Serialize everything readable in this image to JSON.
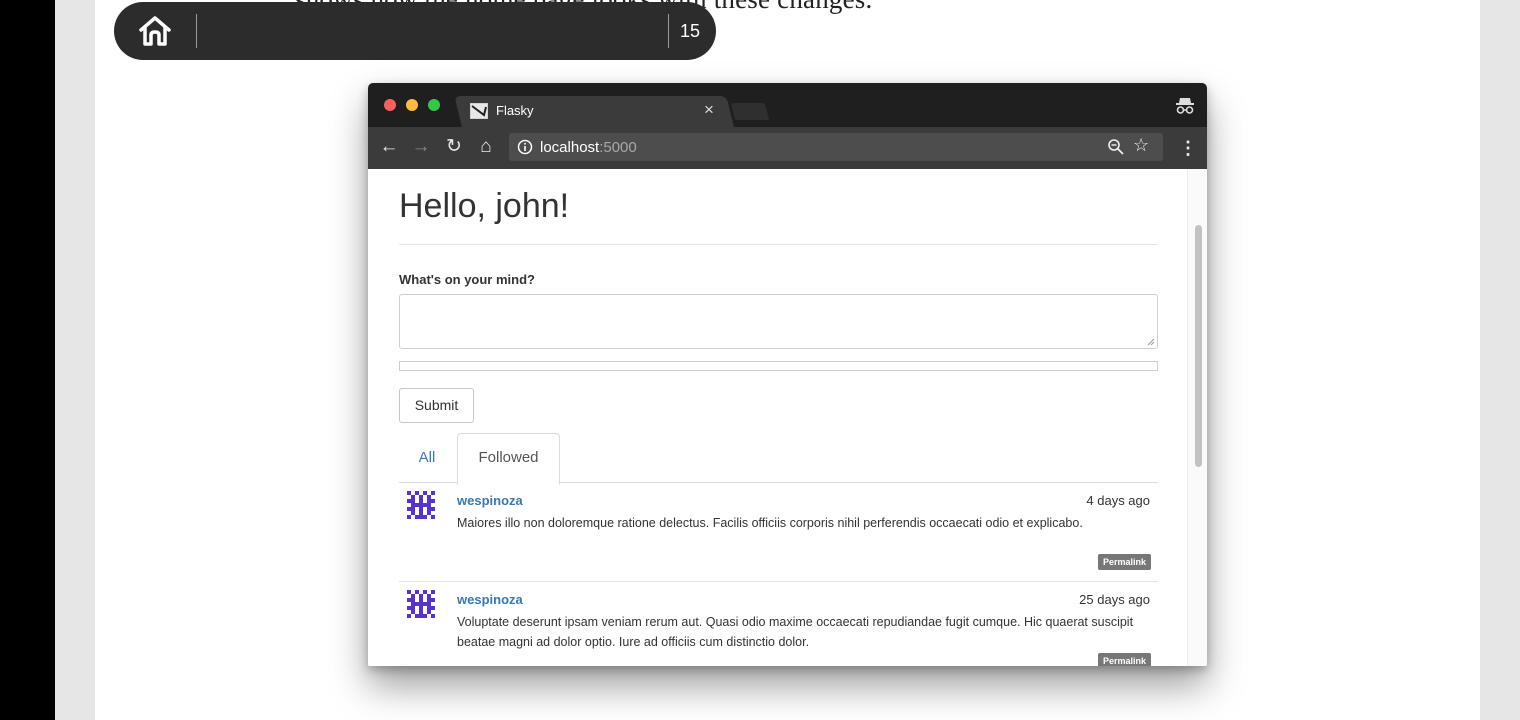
{
  "reader": {
    "book_text": "shows how the home page looks with these changes.",
    "page_number": "15",
    "home_icon": "home-icon"
  },
  "browser": {
    "tab_title": "Flasky",
    "tab_close": "×",
    "url_host": "localhost",
    "url_port": ":5000",
    "icons": [
      "back-arrow-icon",
      "forward-arrow-icon",
      "reload-icon",
      "home-icon",
      "info-icon",
      "zoom-icon",
      "star-icon",
      "kebab-menu-icon",
      "incognito-icon"
    ],
    "traffic_lights": {
      "close": "#fc605c",
      "minimize": "#fdbc40",
      "maximize": "#34c84a"
    }
  },
  "page": {
    "greeting": "Hello, john!",
    "form_label": "What's on your mind?",
    "textarea_value": "",
    "submit_label": "Submit",
    "tabs": [
      {
        "label": "All",
        "active": false
      },
      {
        "label": "Followed",
        "active": true
      }
    ],
    "posts": [
      {
        "author": "wespinoza",
        "date": "4 days ago",
        "body": "Maiores illo non doloremque ratione delectus. Facilis officiis corporis nihil perferendis occaecati odio et explicabo.",
        "permalink": "Permalink"
      },
      {
        "author": "wespinoza",
        "date": "25 days ago",
        "body": "Voluptate deserunt ipsam veniam rerum aut. Quasi odio maxime occaecati repudiandae fugit cumque. Hic quaerat suscipit beatae magni ad dolor optio. Iure ad officiis cum distinctio dolor.",
        "permalink": "Permalink"
      }
    ]
  },
  "colors": {
    "link": "#3879b5",
    "toolbar_dark": "#1f1f1f",
    "reader_bar": "#2c2c2c",
    "avatar": "#5533cc"
  }
}
